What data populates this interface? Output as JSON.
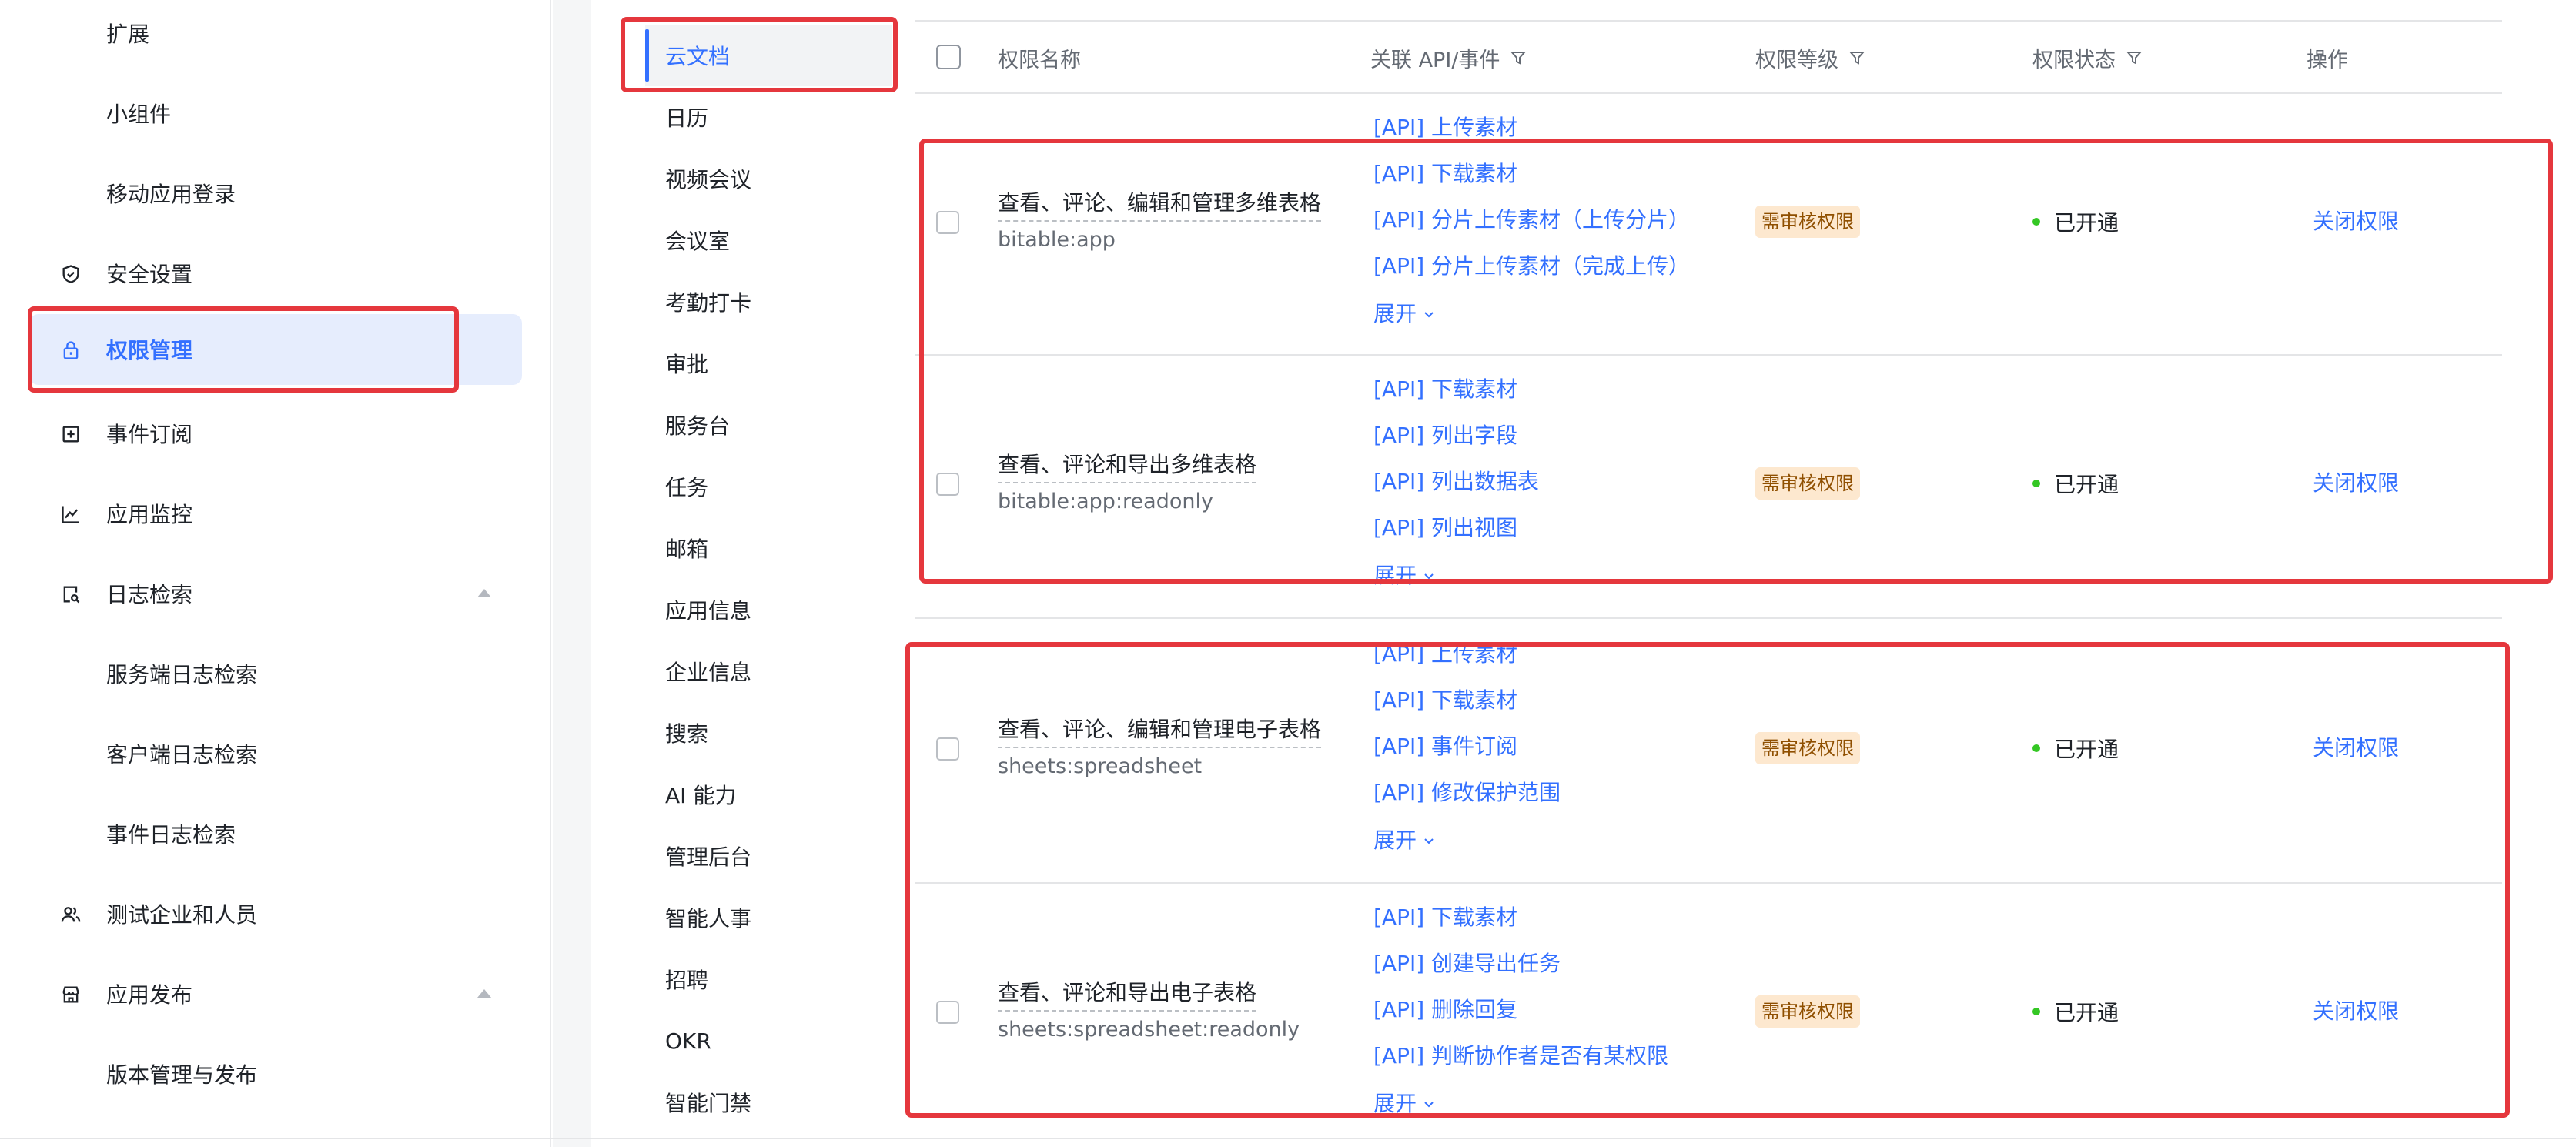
{
  "sidebar": {
    "items": [
      {
        "label": "扩展",
        "icon": "",
        "type": "sub"
      },
      {
        "label": "小组件",
        "icon": "",
        "type": "sub"
      },
      {
        "label": "移动应用登录",
        "icon": "",
        "type": "sub"
      },
      {
        "label": "安全设置",
        "icon": "shield-check-icon",
        "type": "top"
      },
      {
        "label": "权限管理",
        "icon": "lock-icon",
        "type": "top",
        "active": true
      },
      {
        "label": "事件订阅",
        "icon": "plus-square-icon",
        "type": "top"
      },
      {
        "label": "应用监控",
        "icon": "line-chart-icon",
        "type": "top"
      },
      {
        "label": "日志检索",
        "icon": "file-search-icon",
        "type": "top",
        "expanded": true
      },
      {
        "label": "服务端日志检索",
        "icon": "",
        "type": "sub"
      },
      {
        "label": "客户端日志检索",
        "icon": "",
        "type": "sub"
      },
      {
        "label": "事件日志检索",
        "icon": "",
        "type": "sub"
      },
      {
        "label": "测试企业和人员",
        "icon": "users-icon",
        "type": "top"
      },
      {
        "label": "应用发布",
        "icon": "store-icon",
        "type": "top",
        "expanded": true
      },
      {
        "label": "版本管理与发布",
        "icon": "",
        "type": "sub"
      }
    ]
  },
  "categories": {
    "active": "云文档",
    "items": [
      "云文档",
      "日历",
      "视频会议",
      "会议室",
      "考勤打卡",
      "审批",
      "服务台",
      "任务",
      "邮箱",
      "应用信息",
      "企业信息",
      "搜索",
      "AI 能力",
      "管理后台",
      "智能人事",
      "招聘",
      "OKR",
      "智能门禁"
    ]
  },
  "table": {
    "columns": {
      "name": "权限名称",
      "api": "关联 API/事件",
      "level": "权限等级",
      "status": "权限状态",
      "action": "操作"
    },
    "expand_label": "展开",
    "rows": [
      {
        "name": "查看、评论、编辑和管理多维表格",
        "scope": "bitable:app",
        "apis": [
          "[API] 上传素材",
          "[API] 下载素材",
          "[API] 分片上传素材（上传分片）",
          "[API] 分片上传素材（完成上传）"
        ],
        "level": "需审核权限",
        "status": "已开通",
        "action": "关闭权限"
      },
      {
        "name": "查看、评论和导出多维表格",
        "scope": "bitable:app:readonly",
        "apis": [
          "[API] 下载素材",
          "[API] 列出字段",
          "[API] 列出数据表",
          "[API] 列出视图"
        ],
        "level": "需审核权限",
        "status": "已开通",
        "action": "关闭权限"
      },
      {
        "name": "查看、评论、编辑和管理电子表格",
        "scope": "sheets:spreadsheet",
        "apis": [
          "[API] 上传素材",
          "[API] 下载素材",
          "[API] 事件订阅",
          "[API] 修改保护范围"
        ],
        "level": "需审核权限",
        "status": "已开通",
        "action": "关闭权限"
      },
      {
        "name": "查看、评论和导出电子表格",
        "scope": "sheets:spreadsheet:readonly",
        "apis": [
          "[API] 下载素材",
          "[API] 创建导出任务",
          "[API] 删除回复",
          "[API] 判断协作者是否有某权限"
        ],
        "level": "需审核权限",
        "status": "已开通",
        "action": "关闭权限"
      }
    ]
  },
  "colors": {
    "accent": "#3370ff",
    "highlight": "#e5373d",
    "status_on": "#34c724",
    "badge_bg": "#fde8cf"
  }
}
